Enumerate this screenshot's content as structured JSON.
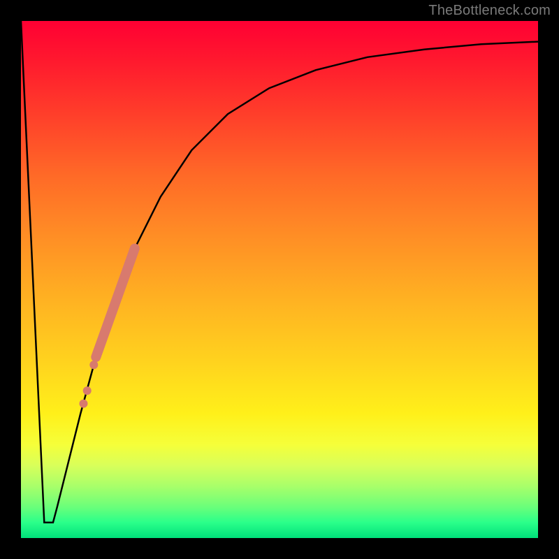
{
  "watermark": "TheBottleneck.com",
  "chart_data": {
    "type": "line",
    "title": "",
    "xlabel": "",
    "ylabel": "",
    "xlim": [
      0,
      1
    ],
    "ylim": [
      0,
      1
    ],
    "grid": false,
    "legend": false,
    "series": [
      {
        "name": "curve",
        "stroke": "#000000",
        "stroke_width": 2.5,
        "x": [
          0.0,
          0.045,
          0.055,
          0.062,
          0.07,
          0.09,
          0.115,
          0.145,
          0.18,
          0.22,
          0.27,
          0.33,
          0.4,
          0.48,
          0.57,
          0.67,
          0.78,
          0.89,
          1.0
        ],
        "y": [
          1.0,
          0.03,
          0.03,
          0.03,
          0.06,
          0.14,
          0.24,
          0.35,
          0.46,
          0.56,
          0.66,
          0.75,
          0.82,
          0.87,
          0.905,
          0.93,
          0.945,
          0.955,
          0.96
        ]
      },
      {
        "name": "highlight-segment",
        "stroke": "#d87a6e",
        "stroke_width": 14,
        "linecap": "round",
        "x": [
          0.145,
          0.22
        ],
        "y": [
          0.35,
          0.56
        ]
      }
    ],
    "scatter": {
      "name": "highlight-dots",
      "color": "#d87a6e",
      "radius": 6,
      "x": [
        0.121,
        0.128,
        0.141,
        0.145
      ],
      "y": [
        0.26,
        0.285,
        0.335,
        0.35
      ]
    },
    "gradient_stops": [
      {
        "pos": 0.0,
        "color": "#ff0033"
      },
      {
        "pos": 0.3,
        "color": "#ff6a27"
      },
      {
        "pos": 0.6,
        "color": "#ffd31e"
      },
      {
        "pos": 0.82,
        "color": "#f5ff3a"
      },
      {
        "pos": 1.0,
        "color": "#00e07a"
      }
    ]
  }
}
